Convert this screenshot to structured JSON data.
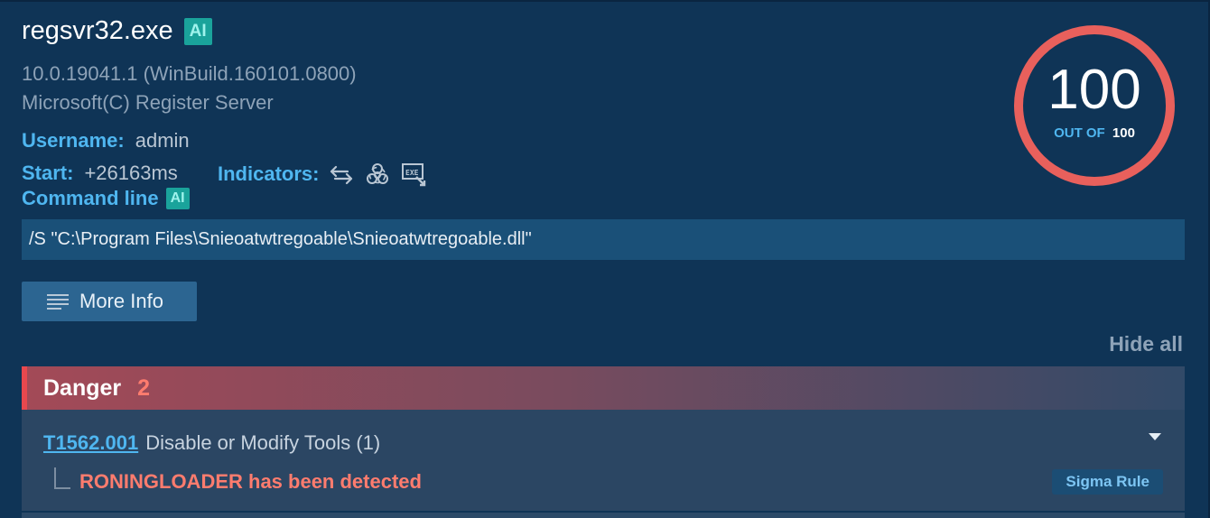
{
  "process": {
    "name": "regsvr32.exe",
    "ai_badge": "AI",
    "version": "10.0.19041.1 (WinBuild.160101.0800)",
    "description": "Microsoft(C) Register Server"
  },
  "details": {
    "username_label": "Username:",
    "username_value": "admin",
    "start_label": "Start:",
    "start_value": "+26163ms",
    "indicators_label": "Indicators:",
    "indicator_icons": [
      "network-arrows-icon",
      "biohazard-icon",
      "exe-file-icon"
    ],
    "cmdline_label": "Command line",
    "cmdline_ai_badge": "AI",
    "cmdline_value": "/S \"C:\\Program Files\\Snieoatwtregoable\\Snieoatwtregoable.dll\""
  },
  "actions": {
    "more_info_label": "More Info",
    "hide_all_label": "Hide all"
  },
  "score": {
    "value": "100",
    "out_of_label": "OUT OF",
    "max": "100",
    "ring_color": "#e8605c"
  },
  "danger": {
    "label": "Danger",
    "count": "2",
    "accent_color": "#e8484e",
    "items": [
      {
        "technique_id": "T1562.001",
        "technique_name": "Disable or Modify Tools (1)",
        "detection": "RONINGLOADER has been detected",
        "rule_badge": "Sigma Rule"
      }
    ]
  }
}
